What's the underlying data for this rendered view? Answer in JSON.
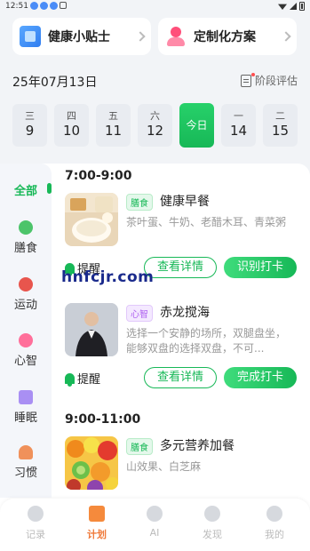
{
  "status_bar": {
    "time": "12:51"
  },
  "top_cards": [
    {
      "title": "健康小贴士",
      "icon": "tips-book-icon"
    },
    {
      "title": "定制化方案",
      "icon": "person-plan-icon"
    }
  ],
  "header": {
    "date": "25年07月13日",
    "stage_eval": "阶段评估"
  },
  "week": [
    {
      "weekday": "三",
      "day": "9"
    },
    {
      "weekday": "四",
      "day": "10"
    },
    {
      "weekday": "五",
      "day": "11"
    },
    {
      "weekday": "六",
      "day": "12"
    },
    {
      "weekday": "今日",
      "day": ""
    },
    {
      "weekday": "一",
      "day": "14"
    },
    {
      "weekday": "二",
      "day": "15"
    }
  ],
  "categories": [
    {
      "label": "全部",
      "active": true
    },
    {
      "label": "膳食"
    },
    {
      "label": "运动"
    },
    {
      "label": "心智"
    },
    {
      "label": "睡眠"
    },
    {
      "label": "习惯"
    }
  ],
  "timeline": [
    {
      "slot": "7:00-9:00",
      "items": [
        {
          "tag": "膳食",
          "title": "健康早餐",
          "desc": "茶叶蛋、牛奶、老醋木耳、青菜粥",
          "remind": "提醒",
          "detail": "查看详情",
          "action": "识别打卡"
        },
        {
          "tag": "心智",
          "title": "赤龙搅海",
          "desc": "选择一个安静的场所，双腿盘坐，能够双盘的选择双盘，不可...",
          "remind": "提醒",
          "detail": "查看详情",
          "action": "完成打卡"
        }
      ]
    },
    {
      "slot": "9:00-11:00",
      "items": [
        {
          "tag": "膳食",
          "title": "多元营养加餐",
          "desc": "山效果、白芝麻"
        }
      ]
    }
  ],
  "watermark": "hnfcjr.com",
  "nav": [
    {
      "label": "记录",
      "icon": "record-heart-icon"
    },
    {
      "label": "计划",
      "icon": "plan-icon",
      "active": true
    },
    {
      "label": "AI",
      "icon": "ai-bot-icon"
    },
    {
      "label": "发现",
      "icon": "discover-chat-icon"
    },
    {
      "label": "我的",
      "icon": "profile-smile-icon"
    }
  ],
  "colors": {
    "accent": "#17b857",
    "nav_active": "#f07a3a",
    "mind_tag": "#b064f0"
  }
}
